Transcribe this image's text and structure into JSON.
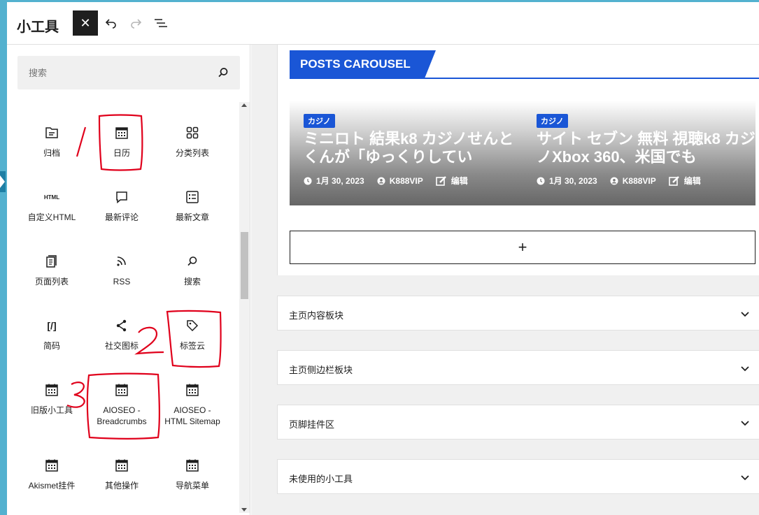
{
  "header": {
    "title": "小工具",
    "close_symbol": "✕",
    "icons": [
      "undo-icon",
      "redo-icon",
      "list-view-icon"
    ]
  },
  "sidebar": {
    "search_placeholder": "搜索",
    "blocks": [
      {
        "label": "归档",
        "icon": "archive-icon"
      },
      {
        "label": "日历",
        "icon": "calendar-icon"
      },
      {
        "label": "分类列表",
        "icon": "categories-icon"
      },
      {
        "label": "自定义HTML",
        "icon": "html-icon",
        "icon_text": "HTML"
      },
      {
        "label": "最新评论",
        "icon": "comment-icon"
      },
      {
        "label": "最新文章",
        "icon": "posts-list-icon"
      },
      {
        "label": "页面列表",
        "icon": "pages-icon"
      },
      {
        "label": "RSS",
        "icon": "rss-icon"
      },
      {
        "label": "搜索",
        "icon": "search-icon"
      },
      {
        "label": "简码",
        "icon": "shortcode-icon",
        "icon_text": "[/]"
      },
      {
        "label": "社交图标",
        "icon": "share-icon"
      },
      {
        "label": "标签云",
        "icon": "tag-icon"
      },
      {
        "label": "旧版小工具",
        "icon": "widget-icon"
      },
      {
        "label": "AIOSEO - Breadcrumbs",
        "icon": "widget-icon"
      },
      {
        "label": "AIOSEO - HTML Sitemap",
        "icon": "widget-icon"
      },
      {
        "label": "Akismet挂件",
        "icon": "widget-icon"
      },
      {
        "label": "其他操作",
        "icon": "widget-icon"
      },
      {
        "label": "导航菜单",
        "icon": "widget-icon"
      }
    ],
    "annotations": [
      "1",
      "2",
      "3"
    ]
  },
  "main": {
    "carousel_title": "POSTS CAROUSEL",
    "posts": [
      {
        "badge": "カジノ",
        "title": "ミニロト 結果k8 カジノせんとくんが「ゆっくりしてい",
        "date": "1月 30, 2023",
        "author": "K888VIP",
        "edit": "编辑"
      },
      {
        "badge": "カジノ",
        "title": "サイト セブン 無料 視聴k8 カジノXbox 360、米国でも",
        "date": "1月 30, 2023",
        "author": "K888VIP",
        "edit": "编辑"
      }
    ],
    "add_symbol": "+",
    "panels": [
      {
        "label": "主页内容板块"
      },
      {
        "label": "主页侧边栏板块"
      },
      {
        "label": "页脚挂件区"
      },
      {
        "label": "未使用的小工具"
      }
    ]
  },
  "colors": {
    "accent_blue": "#1a56d6",
    "edge_blue": "#53b1cf",
    "annotation_red": "#e0001b",
    "dark": "#1e1e1e"
  }
}
